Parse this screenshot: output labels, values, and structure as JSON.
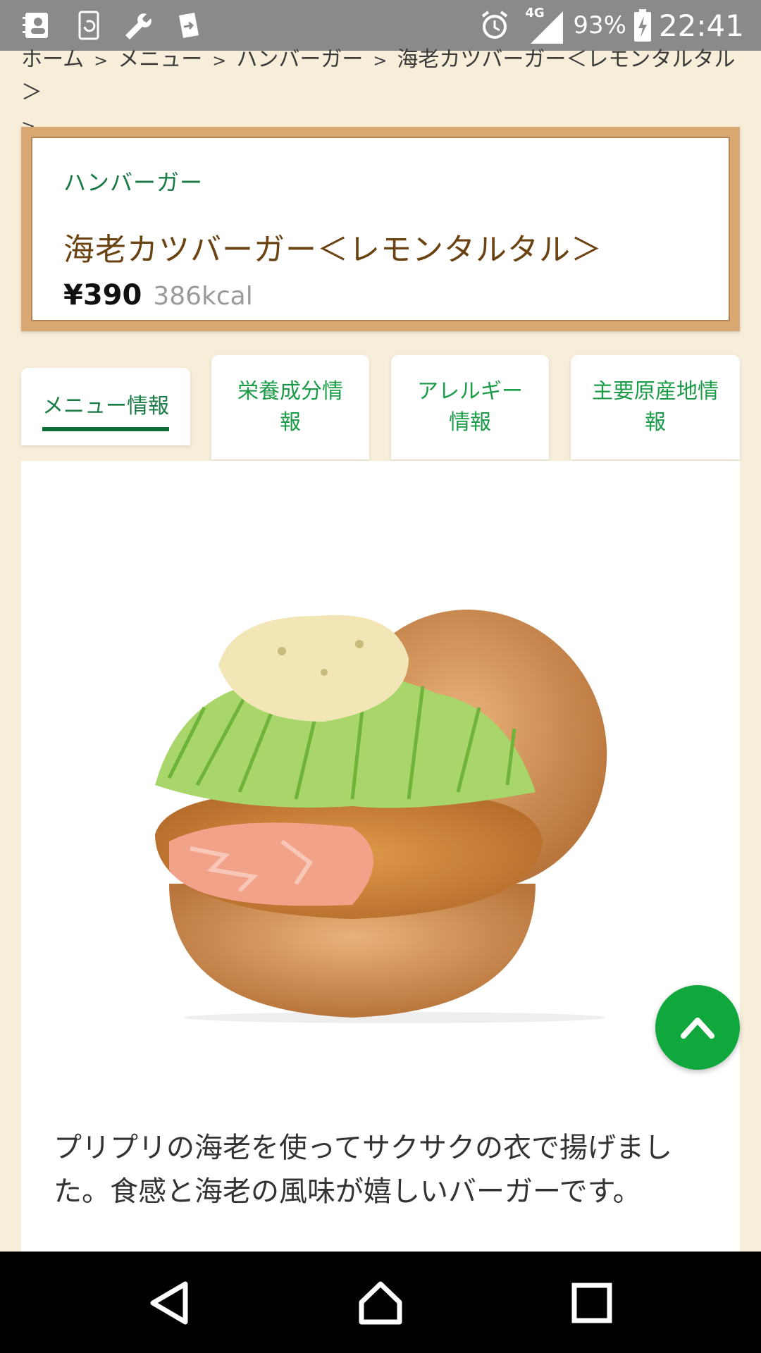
{
  "status_bar": {
    "network": "4G",
    "battery": "93%",
    "time": "22:41",
    "left_icons": [
      "contacts-icon",
      "sync-icon",
      "wrench-icon",
      "file-transfer-icon"
    ]
  },
  "breadcrumb": {
    "items": [
      "ホーム",
      "メニュー",
      "ハンバーガー",
      "海老カツバーガー＜レモンタルタル＞"
    ],
    "separator": ">"
  },
  "product": {
    "category": "ハンバーガー",
    "name": "海老カツバーガー＜レモンタルタル＞",
    "price": "¥390",
    "calories": "386kcal"
  },
  "tabs": [
    {
      "label": "メニュー情報",
      "active": true
    },
    {
      "label": "栄養成分情報",
      "active": false
    },
    {
      "label": "アレルギー情報",
      "active": false
    },
    {
      "label": "主要原産地情報",
      "active": false
    }
  ],
  "description": "プリプリの海老を使ってサクサクの衣で揚げました。食感と海老の風味が嬉しいバーガーです。",
  "colors": {
    "background": "#f7eeda",
    "accent_green": "#10a83c",
    "title_brown": "#6b4312",
    "frame_wood": "#d9a772"
  }
}
